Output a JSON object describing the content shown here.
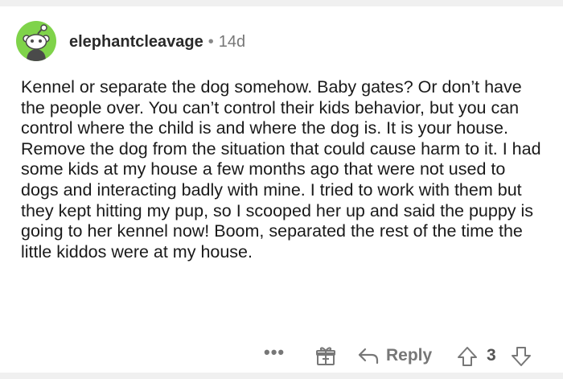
{
  "comment": {
    "username": "elephantcleavage",
    "separator": "•",
    "age": "14d",
    "body": "Kennel or separate the dog somehow. Baby gates? Or don’t have the people over. You can’t control their kids behavior, but you can control where the child is and where the dog is. It is your house. Remove the dog from the situation that could cause harm to it. I had some kids at my house a few months ago that were not used to dogs and interacting badly with mine. I tried to work with them but they kept hitting my pup, so I scooped her up and said the puppy is going to her kennel now! Boom, separated the rest of the time the little kiddos were at my house."
  },
  "actions": {
    "more_label": "•••",
    "award_icon": "gift-icon",
    "reply_icon": "reply-arrow-icon",
    "reply_label": "Reply",
    "upvote_icon": "arrow-up-icon",
    "score": "3",
    "downvote_icon": "arrow-down-icon"
  },
  "colors": {
    "avatar_bg": "#7fd34a",
    "text": "#1a1a1a",
    "muted": "#777777"
  }
}
